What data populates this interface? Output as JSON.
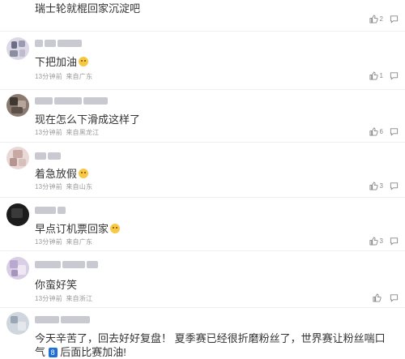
{
  "top_comment": {
    "text": "瑞士轮就棍回家沉淀吧",
    "likes": "2"
  },
  "comments": [
    {
      "text": "下把加油",
      "emoji": "cry",
      "time": "13分钟前",
      "source": "来自广东",
      "likes": "1"
    },
    {
      "text": "现在怎么下滑成这样了",
      "emoji": "",
      "time": "13分钟前",
      "source": "来自黑龙江",
      "likes": "6"
    },
    {
      "text": "着急放假",
      "emoji": "smile",
      "time": "13分钟前",
      "source": "来自山东",
      "likes": "3"
    },
    {
      "text": "早点订机票回家",
      "emoji": "grin",
      "time": "13分钟前",
      "source": "来自广东",
      "likes": "3"
    },
    {
      "text": "你蛮好笑",
      "emoji": "",
      "time": "13分钟前",
      "source": "来自浙江",
      "likes": ""
    }
  ],
  "last_comment": {
    "line1": "今天辛苦了，回去好好复盘！ 夏季赛已经很折磨粉丝了，世界赛让粉丝喘口",
    "line2_pre": "气",
    "badge": "8",
    "line2_post": "后面比赛加油!"
  },
  "colors": {
    "meta_text": "#999999",
    "badge_bg": "#1e6fd9"
  }
}
